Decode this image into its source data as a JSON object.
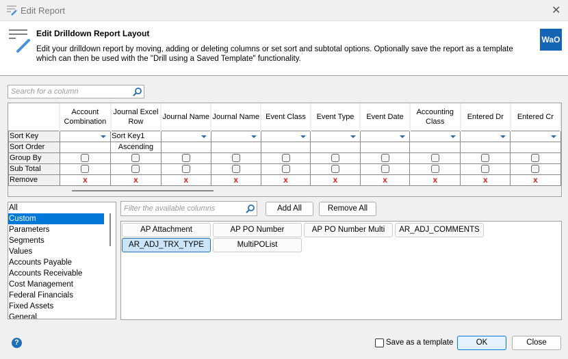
{
  "window": {
    "title": "Edit Report",
    "close_icon": "close-icon"
  },
  "header": {
    "title": "Edit Drilldown Report Layout",
    "description": "Edit your drilldown report by moving, adding or deleting columns or set sort and subtotal options. Optionally save the report as a template which can then be used with the \"Drill using a Saved Template\" functionality.",
    "logo_text": "WaO"
  },
  "search": {
    "placeholder": "Search for a column"
  },
  "grid": {
    "columns": [
      "Account Combination",
      "Journal Excel Row",
      "Journal Name",
      "Journal Name",
      "Event Class",
      "Event Type",
      "Event Date",
      "Accounting Class",
      "Entered Dr",
      "Entered Cr"
    ],
    "row_labels": {
      "sort_key": "Sort Key",
      "sort_order": "Sort Order",
      "group_by": "Group By",
      "sub_total": "Sub Total",
      "remove": "Remove"
    },
    "sort_keys": [
      "",
      "Sort Key1",
      "",
      "",
      "",
      "",
      "",
      "",
      "",
      ""
    ],
    "sort_orders": [
      "",
      "Ascending",
      "",
      "",
      "",
      "",
      "",
      "",
      "",
      ""
    ],
    "remove_glyph": "x"
  },
  "categories": {
    "items": [
      "All",
      "Custom",
      "Parameters",
      "Segments",
      "Values",
      "Accounts Payable",
      "Accounts Receivable",
      "Cost Management",
      "Federal Financials",
      "Fixed Assets",
      "General"
    ],
    "selected": "Custom"
  },
  "filter": {
    "placeholder": "Filter the available columns"
  },
  "buttons": {
    "add_all": "Add All",
    "remove_all": "Remove All",
    "ok": "OK",
    "close": "Close"
  },
  "available_columns": {
    "items": [
      "AP Attachment",
      "AP PO Number",
      "AP PO Number Multi",
      "AR_ADJ_COMMENTS",
      "AR_ADJ_TRX_TYPE",
      "MultiPOList"
    ],
    "selected": "AR_ADJ_TRX_TYPE"
  },
  "footer": {
    "save_template_label": "Save as a template",
    "save_template_checked": false,
    "help_glyph": "?"
  },
  "colors": {
    "accent": "#0078d7",
    "remove": "#e02020",
    "logo": "#1565b4"
  }
}
